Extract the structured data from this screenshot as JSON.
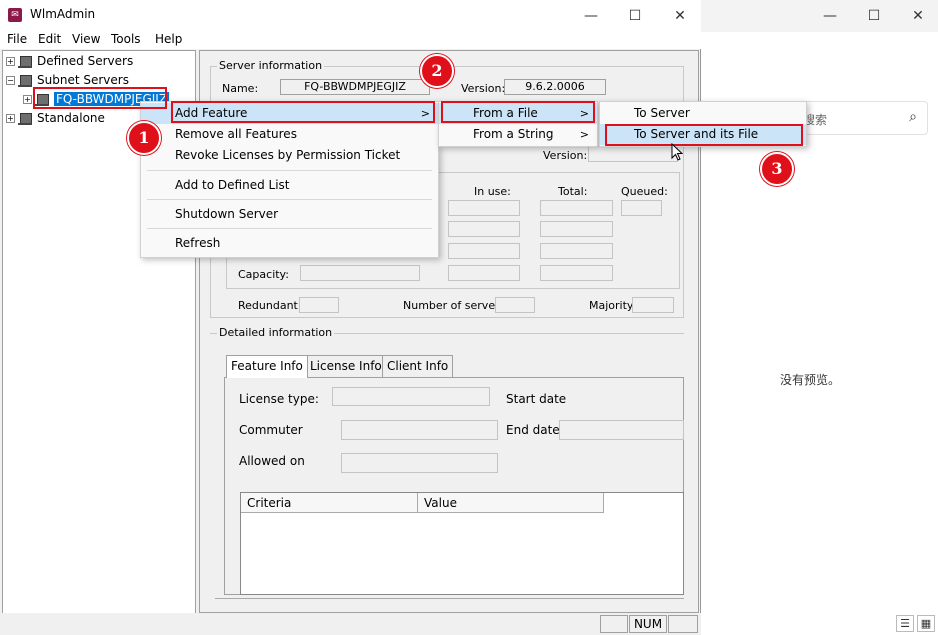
{
  "app": {
    "title": "WlmAdmin",
    "icon_glyph": "✉",
    "window_controls": {
      "minimize": "—",
      "maximize": "☐",
      "close": "✕"
    },
    "menu": [
      "File",
      "Edit",
      "View",
      "Tools",
      "Help"
    ]
  },
  "tree": {
    "expander_plus": "+",
    "expander_minus": "−",
    "nodes": [
      {
        "label": "Defined Servers",
        "expanded": false
      },
      {
        "label": "Subnet Servers",
        "expanded": true
      },
      {
        "label": "FQ-BBWDMPJEGJIZ",
        "selected": true
      },
      {
        "label": "Standalone",
        "expanded": false
      }
    ]
  },
  "server_info": {
    "group_label": "Server information",
    "name_label": "Name:",
    "name_value": "FQ-BBWDMPJEGJIZ",
    "version_label": "Version:",
    "version_value": "9.6.2.0006",
    "version2_label": "Version:",
    "in_use_label": "In use:",
    "total_label": "Total:",
    "queued_label": "Queued:",
    "capacity_label": "Capacity:",
    "redundant_label": "Redundant:",
    "num_servers_label": "Number of servers:",
    "majority_label": "Majority:"
  },
  "detailed": {
    "group_label": "Detailed information",
    "tabs": [
      "Feature Info",
      "License Info",
      "Client Info"
    ],
    "license_type_label": "License type:",
    "start_date_label": "Start date",
    "commuter_label": "Commuter",
    "end_date_label": "End date:",
    "allowed_on_label": "Allowed on",
    "columns": [
      "Criteria",
      "Value"
    ]
  },
  "statusbar": {
    "num": "NUM"
  },
  "context_menu": {
    "items": [
      "Add Feature",
      "Remove all Features",
      "Revoke Licenses by Permission Ticket",
      "Add to Defined List",
      "Shutdown Server",
      "Refresh"
    ]
  },
  "submenu": {
    "items": [
      "From a File",
      "From a String"
    ]
  },
  "submenu2": {
    "items": [
      "To Server",
      "To Server and its File"
    ]
  },
  "submenu_arrow": ">",
  "annotations": {
    "step1": "1",
    "step2": "2",
    "step3": "3"
  },
  "background_window": {
    "search_placeholder": "搜索",
    "search_icon_glyph": "⌕",
    "no_preview": "没有预览。",
    "controls": {
      "minimize": "—",
      "maximize": "☐",
      "close": "✕"
    },
    "view_buttons": [
      "☰",
      "▦"
    ]
  },
  "colors": {
    "annotation_red": "#e0101a",
    "selection_blue": "#0078d7",
    "menu_highlight": "#cce4f7"
  }
}
